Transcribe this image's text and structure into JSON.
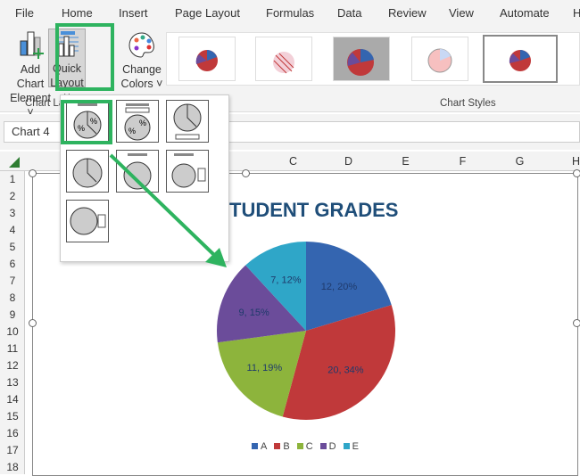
{
  "menu": [
    "File",
    "Home",
    "Insert",
    "Page Layout",
    "Formulas",
    "Data",
    "Review",
    "View",
    "Automate",
    "H"
  ],
  "ribbon": {
    "add_chart_element": [
      "Add Chart",
      "Element ˅"
    ],
    "quick_layout": [
      "Quick",
      "Layout ˅"
    ],
    "change_colors": [
      "Change",
      "Colors ˅"
    ],
    "group_chart_layouts": "Chart La",
    "group_chart_styles": "Chart Styles"
  },
  "name_box": "Chart 4",
  "columns": [
    "C",
    "D",
    "E",
    "F",
    "G",
    "H"
  ],
  "rows": [
    "1",
    "2",
    "3",
    "4",
    "5",
    "6",
    "7",
    "8",
    "9",
    "10",
    "11",
    "12",
    "13",
    "14",
    "15",
    "16",
    "17",
    "18"
  ],
  "chart_data": {
    "type": "pie",
    "title": "STUDENT GRADES",
    "visible_title": "TUDENT GRADES",
    "categories": [
      "A",
      "B",
      "C",
      "D",
      "E"
    ],
    "values": [
      12,
      20,
      11,
      9,
      7
    ],
    "labels": [
      "12, 20%",
      "20, 34%",
      "11, 19%",
      "9, 15%",
      "7, 12%"
    ],
    "colors": [
      "#3465b0",
      "#c0393a",
      "#8db43c",
      "#6b4c9a",
      "#2fa6c8"
    ],
    "legend_position": "bottom"
  },
  "highlight_color": "#2eb35f"
}
